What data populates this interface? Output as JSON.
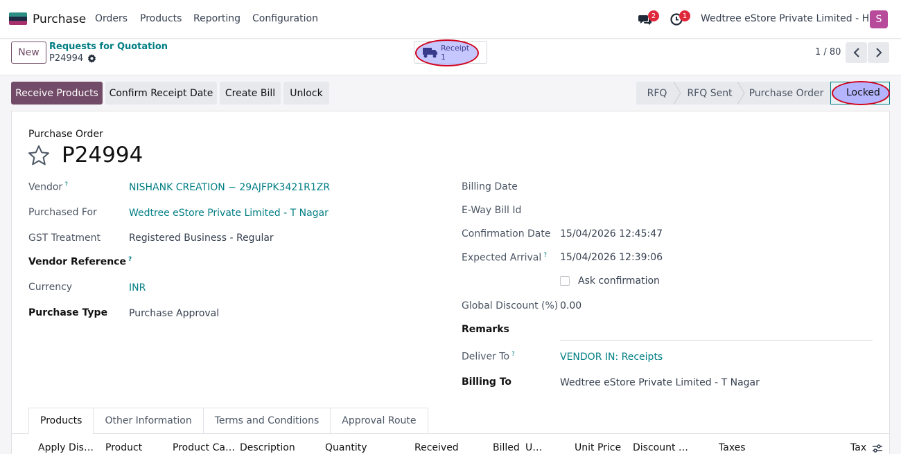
{
  "navbar": {
    "brand": "Purchase",
    "menu": [
      "Orders",
      "Products",
      "Reporting",
      "Configuration"
    ],
    "messages_count": "2",
    "activities_count": "1",
    "company": "Wedtree eStore Private Limited - HO",
    "avatar_letter": "S",
    "colors": {
      "logo_top": "#2d8f84",
      "logo_mid": "#1e2a44",
      "logo_bottom": "#a6306b",
      "avatar": "#b84a9b",
      "badge": "#e0283b"
    }
  },
  "control": {
    "new_label": "New",
    "breadcrumb_parent": "Requests for Quotation",
    "breadcrumb_current": "P24994",
    "smart_button": {
      "label": "Receipt",
      "count": "1",
      "icon": "truck-icon"
    },
    "pager": "1 / 80"
  },
  "statusbar": {
    "actions": [
      "Receive Products",
      "Confirm Receipt Date",
      "Create Bill",
      "Unlock"
    ],
    "stages": [
      "RFQ",
      "RFQ Sent",
      "Purchase Order",
      "Locked"
    ],
    "current_stage": "Locked",
    "colors": {
      "primary": "#714b67",
      "accent": "#017e84"
    }
  },
  "form": {
    "kind": "Purchase Order",
    "name": "P24994",
    "left": {
      "vendor_label": "Vendor",
      "vendor_value": "NISHANK CREATION − 29AJFPK3421R1ZR",
      "purchased_for_label": "Purchased For",
      "purchased_for_value": "Wedtree eStore Private Limited - T Nagar",
      "gst_label": "GST Treatment",
      "gst_value": "Registered Business - Regular",
      "vendor_ref_label": "Vendor Reference",
      "currency_label": "Currency",
      "currency_value": "INR",
      "purchase_type_label": "Purchase Type",
      "purchase_type_value": "Purchase Approval"
    },
    "right": {
      "billing_date_label": "Billing Date",
      "eway_label": "E-Way Bill Id",
      "confirmation_label": "Confirmation Date",
      "confirmation_value": "15/04/2026 12:45:47",
      "expected_label": "Expected Arrival",
      "expected_value": "15/04/2026 12:39:06",
      "ask_confirmation_label": "Ask confirmation",
      "discount_label": "Global Discount (%)",
      "discount_value": "0.00",
      "remarks_label": "Remarks",
      "deliver_label": "Deliver To",
      "deliver_value": "VENDOR IN: Receipts",
      "billing_to_label": "Billing To",
      "billing_to_value": "Wedtree eStore Private Limited - T Nagar"
    },
    "help_mark": "?"
  },
  "tabs": [
    "Products",
    "Other Information",
    "Terms and Conditions",
    "Approval Route"
  ],
  "table": {
    "headers": [
      "Apply Dis…",
      "Product",
      "Product Ca…",
      "Description",
      "Quantity",
      "Received",
      "Billed",
      "U…",
      "Unit Price",
      "Discount …",
      "Taxes",
      "Tax"
    ]
  }
}
